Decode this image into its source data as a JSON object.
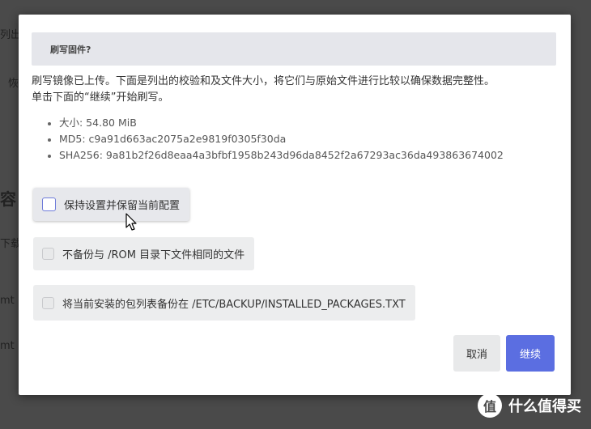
{
  "background": {
    "fragments": [
      "列出",
      "恢",
      "容",
      "下载",
      "mt",
      "mt"
    ]
  },
  "modal": {
    "title": "刷写固件?",
    "description_line1": "刷写镜像已上传。下面是列出的校验和及文件大小，将它们与原始文件进行比较以确保数据完整性。",
    "description_line2": "单击下面的“继续”开始刷写。",
    "info": {
      "size": "大小: 54.80 MiB",
      "md5": "MD5: c9a91d663ac2075a2e9819f0305f30da",
      "sha256": "SHA256: 9a81b2f26d8eaa4a3bfbf1958b243d96da8452f2a67293ac36da493863674002"
    },
    "options": {
      "keep_settings": {
        "label": "保持设置并保留当前配置",
        "checked": false
      },
      "skip_rom_backup": {
        "label": "不备份与 /ROM 目录下文件相同的文件",
        "checked": false
      },
      "backup_packages": {
        "label": "将当前安装的包列表备份在 /ETC/BACKUP/INSTALLED_PACKAGES.TXT",
        "checked": false
      }
    },
    "buttons": {
      "cancel": "取消",
      "continue": "继续"
    }
  },
  "watermark": {
    "logo_char": "值",
    "text": "什么值得买"
  },
  "colors": {
    "accent": "#5b6ee1",
    "header_bg": "#e5e6eb",
    "overlay": "#4a4a4a"
  }
}
